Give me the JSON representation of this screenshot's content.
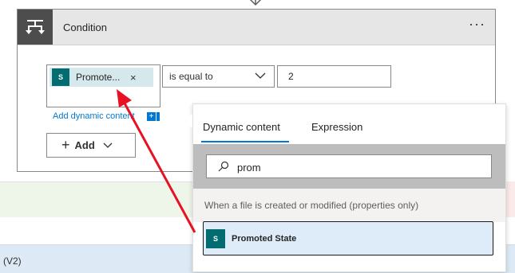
{
  "condition_card": {
    "title": "Condition",
    "more": "···",
    "token_label": "Promote...",
    "token_remove": "×",
    "token_icon": "sharepoint-icon",
    "operator": "is equal to",
    "value": "2",
    "add_dynamic_content": "Add dynamic content",
    "add_button": "Add"
  },
  "dynamic_panel": {
    "tabs": [
      "Dynamic content",
      "Expression"
    ],
    "active_tab": "Dynamic content",
    "search_value": "prom",
    "section_title": "When a file is created or modified (properties only)",
    "results": [
      {
        "label": "Promoted State",
        "icon": "sharepoint-icon"
      }
    ]
  },
  "background": {
    "lower_text": "(V2)"
  },
  "colors": {
    "accent": "#0078d4",
    "sharepoint": "#036c70",
    "arrow": "#e81123"
  }
}
